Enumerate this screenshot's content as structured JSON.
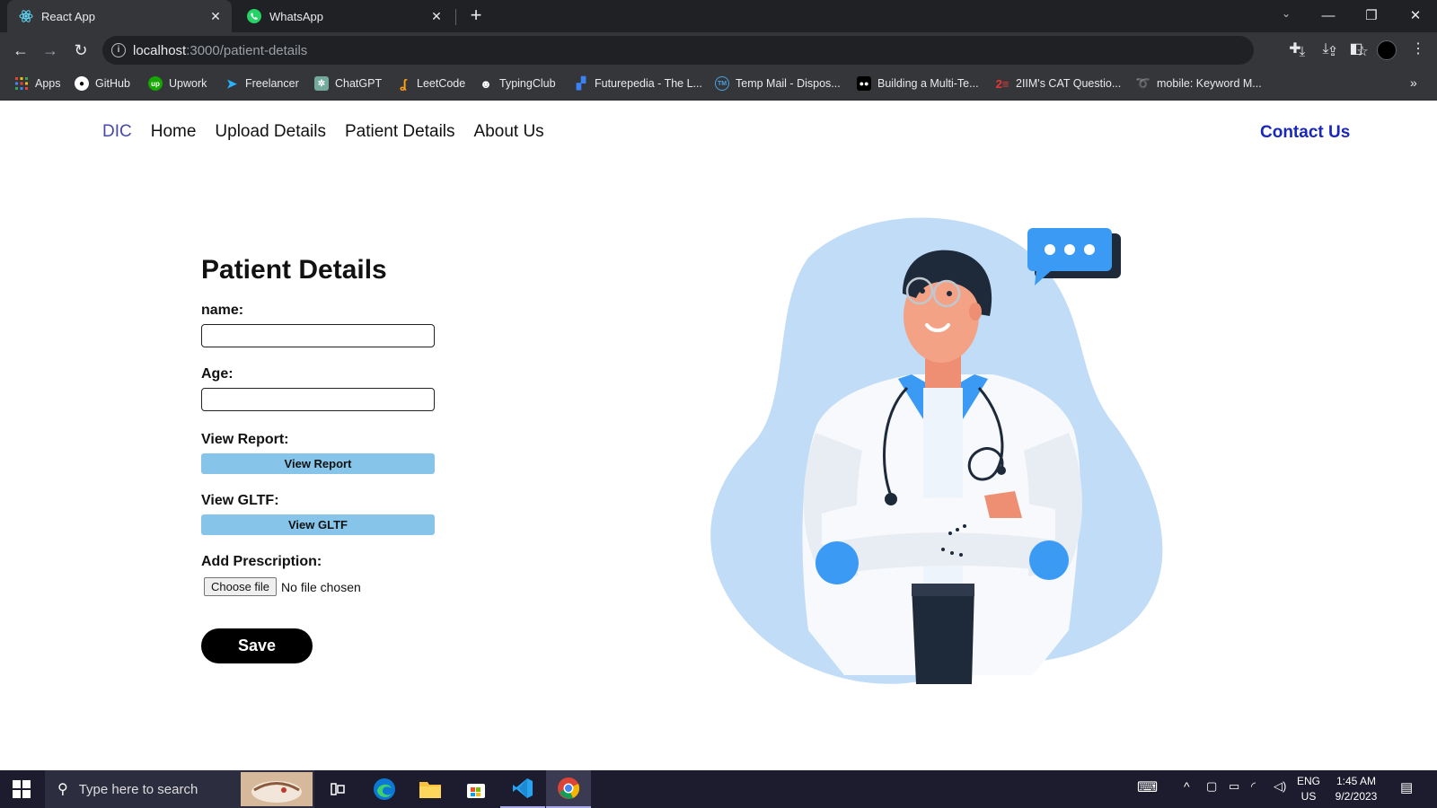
{
  "browser": {
    "tabs": [
      {
        "title": "React App",
        "active": true,
        "favicon": "react-icon"
      },
      {
        "title": "WhatsApp",
        "active": false,
        "favicon": "whatsapp-icon"
      }
    ],
    "new_tab": "+",
    "address": {
      "host": "localhost",
      "path": ":3000/patient-details"
    },
    "bookmarks": [
      {
        "label": "Apps",
        "icon": "apps-grid-icon"
      },
      {
        "label": "GitHub",
        "icon": "github-icon"
      },
      {
        "label": "Upwork",
        "icon": "upwork-icon"
      },
      {
        "label": "Freelancer",
        "icon": "freelancer-icon"
      },
      {
        "label": "ChatGPT",
        "icon": "chatgpt-icon"
      },
      {
        "label": "LeetCode",
        "icon": "leetcode-icon"
      },
      {
        "label": "TypingClub",
        "icon": "typingclub-icon"
      },
      {
        "label": "Futurepedia - The L...",
        "icon": "futurepedia-icon"
      },
      {
        "label": "Temp Mail - Dispos...",
        "icon": "tempmail-icon"
      },
      {
        "label": "Building a Multi-Te...",
        "icon": "medium-icon"
      },
      {
        "label": "2IIM's CAT Questio...",
        "icon": "2iim-icon"
      },
      {
        "label": "mobile: Keyword M...",
        "icon": "keyword-icon"
      }
    ]
  },
  "site_nav": {
    "brand": "DIC",
    "links": [
      "Home",
      "Upload Details",
      "Patient Details",
      "About Us"
    ],
    "contact": "Contact Us"
  },
  "form": {
    "title": "Patient Details",
    "name_label": "name:",
    "name_value": "",
    "age_label": "Age:",
    "age_value": "",
    "report_label": "View Report:",
    "report_button": "View Report",
    "gltf_label": "View GLTF:",
    "gltf_button": "View GLTF",
    "prescription_label": "Add Prescription:",
    "choose_file": "Choose file",
    "no_file": "No file chosen",
    "save": "Save"
  },
  "taskbar": {
    "search_placeholder": "Type here to search",
    "lang_top": "ENG",
    "lang_bottom": "US",
    "time": "1:45 AM",
    "date": "9/2/2023"
  },
  "colors": {
    "accent_blue": "#86c5e9",
    "contact_blue": "#1a27b8",
    "brand_purple": "#4848a8"
  }
}
